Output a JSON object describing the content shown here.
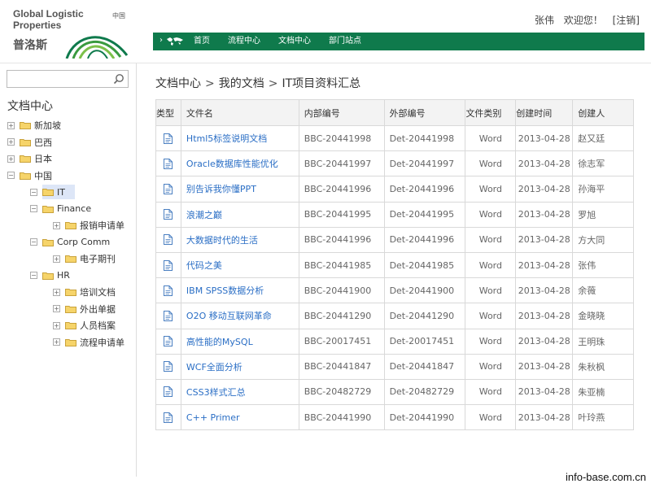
{
  "brand": {
    "en_line1": "Global Logistic",
    "en_line2": "Properties",
    "cn_name": "普洛斯",
    "country": "中国",
    "color": "#0f7a4c"
  },
  "user": {
    "name": "张伟",
    "welcome": "欢迎您！",
    "logout": "[注销]"
  },
  "nav": {
    "arrow": "›",
    "items": [
      "首页",
      "流程中心",
      "文档中心",
      "部门站点"
    ]
  },
  "sidebar": {
    "search_value": "",
    "title": "文档中心",
    "tree": [
      {
        "label": "新加坡",
        "level": 0,
        "expander": "+"
      },
      {
        "label": "巴西",
        "level": 0,
        "expander": "+"
      },
      {
        "label": "日本",
        "level": 0,
        "expander": "+"
      },
      {
        "label": "中国",
        "level": 0,
        "expander": "−"
      },
      {
        "label": "IT",
        "level": 1,
        "expander": "−",
        "selected": true
      },
      {
        "label": "Finance",
        "level": 1,
        "expander": "−"
      },
      {
        "label": "报销申请单",
        "level": 2,
        "expander": "+"
      },
      {
        "label": "Corp Comm",
        "level": 1,
        "expander": "−"
      },
      {
        "label": "电子期刊",
        "level": 2,
        "expander": "+"
      },
      {
        "label": "HR",
        "level": 1,
        "expander": "−"
      },
      {
        "label": "培训文档",
        "level": 2,
        "expander": "+"
      },
      {
        "label": "外出单据",
        "level": 2,
        "expander": "+"
      },
      {
        "label": "人员档案",
        "level": 2,
        "expander": "+"
      },
      {
        "label": "流程申请单",
        "level": 2,
        "expander": "+"
      }
    ]
  },
  "breadcrumb": [
    "文档中心",
    "我的文档",
    "IT项目资料汇总"
  ],
  "breadcrumb_sep": ">",
  "table": {
    "headers": [
      "类型",
      "文件名",
      "内部编号",
      "外部编号",
      "文件类别",
      "创建时间",
      "创建人"
    ],
    "rows": [
      {
        "name": "Html5标签说明文档",
        "internal": "BBC-20441998",
        "external": "Det-20441998",
        "kind": "Word",
        "date": "2013-04-28",
        "creator": "赵又廷"
      },
      {
        "name": "Oracle数据库性能优化",
        "internal": "BBC-20441997",
        "external": "Det-20441997",
        "kind": "Word",
        "date": "2013-04-28",
        "creator": "徐志军"
      },
      {
        "name": "别告诉我你懂PPT",
        "internal": "BBC-20441996",
        "external": "Det-20441996",
        "kind": "Word",
        "date": "2013-04-28",
        "creator": "孙海平"
      },
      {
        "name": "浪潮之巅",
        "internal": "BBC-20441995",
        "external": "Det-20441995",
        "kind": "Word",
        "date": "2013-04-28",
        "creator": "罗旭"
      },
      {
        "name": "大数据时代的生活",
        "internal": "BBC-20441996",
        "external": "Det-20441996",
        "kind": "Word",
        "date": "2013-04-28",
        "creator": "方大同"
      },
      {
        "name": "代码之美",
        "internal": "BBC-20441985",
        "external": "Det-20441985",
        "kind": "Word",
        "date": "2013-04-28",
        "creator": "张伟"
      },
      {
        "name": "IBM SPSS数据分析",
        "internal": "BBC-20441900",
        "external": "Det-20441900",
        "kind": "Word",
        "date": "2013-04-28",
        "creator": "余薇"
      },
      {
        "name": "O2O 移动互联网革命",
        "internal": "BBC-20441290",
        "external": "Det-20441290",
        "kind": "Word",
        "date": "2013-04-28",
        "creator": "金晓晓"
      },
      {
        "name": "高性能的MySQL",
        "internal": "BBC-20017451",
        "external": "Det-20017451",
        "kind": "Word",
        "date": "2013-04-28",
        "creator": "王明珠"
      },
      {
        "name": "WCF全面分析",
        "internal": "BBC-20441847",
        "external": "Det-20441847",
        "kind": "Word",
        "date": "2013-04-28",
        "creator": "朱秋枫"
      },
      {
        "name": "CSS3样式汇总",
        "internal": "BBC-20482729",
        "external": "Det-20482729",
        "kind": "Word",
        "date": "2013-04-28",
        "creator": "朱亚楠"
      },
      {
        "name": "C++ Primer",
        "internal": "BBC-20441990",
        "external": "Det-20441990",
        "kind": "Word",
        "date": "2013-04-28",
        "creator": "叶玲燕"
      }
    ]
  },
  "watermark": "info-base.com.cn"
}
